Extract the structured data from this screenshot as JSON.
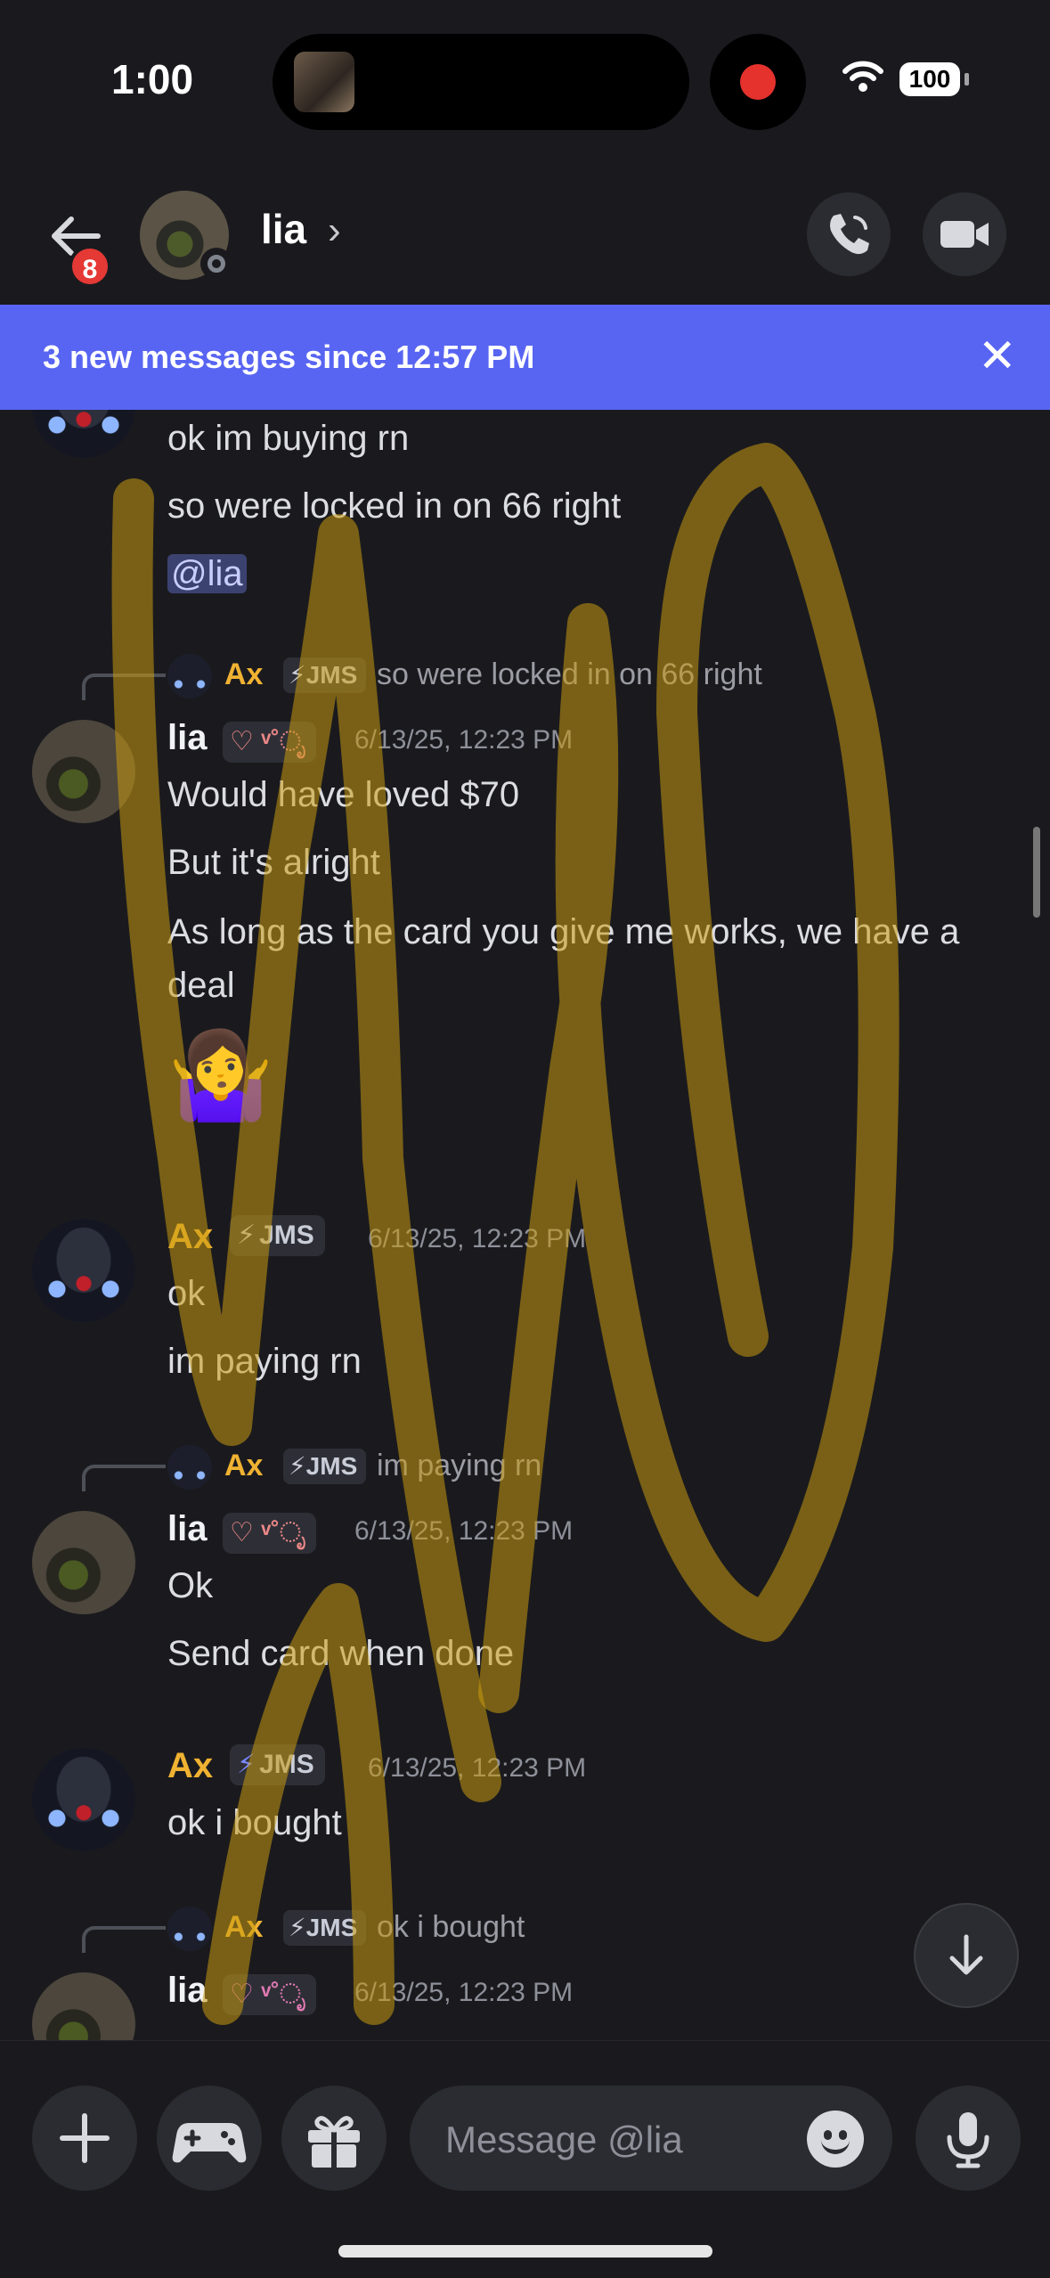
{
  "status_bar": {
    "time": "1:00",
    "battery": "100"
  },
  "header": {
    "name": "lia",
    "chevron": "›",
    "unread_badge": "8"
  },
  "banner": {
    "text": "3 new messages since 12:57 PM",
    "close": "✕"
  },
  "messages": {
    "top": {
      "lines": [
        "ok im buying rn",
        "so were locked in on 66 right"
      ],
      "mention": "@lia"
    },
    "m1": {
      "reply": {
        "name": "Ax",
        "tag": "JMS",
        "text": "so were locked in on 66 right"
      },
      "name": "lia",
      "tag": "♡ ᵛ˚ೃ",
      "timestamp": "6/13/25, 12:23 PM",
      "lines": [
        "Would have loved $70",
        "But it's alright",
        "As long as the card you give me works, we have a deal"
      ],
      "emoji": "🤷‍♀️"
    },
    "m2": {
      "name": "Ax",
      "tag": "JMS",
      "timestamp": "6/13/25, 12:23 PM",
      "lines": [
        "ok",
        "im paying rn"
      ]
    },
    "m3": {
      "reply": {
        "name": "Ax",
        "tag": "JMS",
        "text": "im paying rn"
      },
      "name": "lia",
      "tag": "♡ ᵛ˚ೃ",
      "timestamp": "6/13/25, 12:23 PM",
      "lines": [
        "Ok",
        "Send card when done"
      ]
    },
    "m4": {
      "name": "Ax",
      "tag": "JMS",
      "timestamp": "6/13/25, 12:23 PM",
      "lines": [
        "ok i bought"
      ]
    },
    "m5": {
      "reply": {
        "name": "Ax",
        "tag": "JMS",
        "text": "ok i bought"
      },
      "name": "lia",
      "tag": "♡ ᵛ˚ೃ",
      "timestamp": "6/13/25, 12:23 PM"
    }
  },
  "composer": {
    "placeholder": "Message @lia"
  },
  "colors": {
    "accent": "#5865f2",
    "ax_name": "#f0b232",
    "background": "#1a1a1e",
    "scribble": "#c89b10"
  },
  "icons": [
    "arrow-left-icon",
    "chevron-right-icon",
    "phone-icon",
    "video-camera-icon",
    "close-icon",
    "plus-icon",
    "gamepad-icon",
    "gift-icon",
    "emoji-icon",
    "microphone-icon",
    "arrow-down-icon",
    "lightning-icon",
    "wifi-icon"
  ]
}
